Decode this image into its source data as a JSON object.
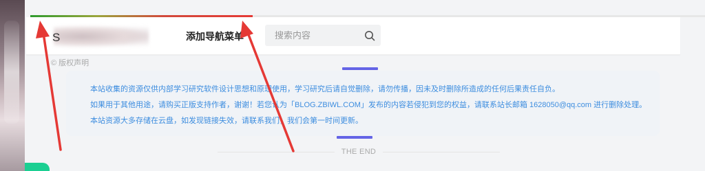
{
  "reading_progress": 0.33,
  "header": {
    "logo_letter": "S",
    "nav_item": "添加导航菜单",
    "search": {
      "placeholder": "搜索内容",
      "visible_text": "搜索内容"
    }
  },
  "article": {
    "copyright": "© 版权声明",
    "notice_lines": [
      "本站收集的资源仅供内部学习研究软件设计思想和原理使用，学习研究后请自觉删除，请勿传播，因未及时删除所造成的任何后果责任自负。",
      "如果用于其他用途，请购买正版支持作者，谢谢！若您认为「BLOG.ZBIWL.COM」发布的内容若侵犯到您的权益，请联系站长邮箱 1628050@qq.com 进行删除处理。",
      "本站资源大多存储在云盘，如发现链接失效，请联系我们，我们会第一时间更新。"
    ],
    "end_text": "THE END"
  },
  "colors": {
    "accent": "#6464e6",
    "notice_text": "#3d8ddf",
    "annotation_arrow": "#e53935",
    "float_button": "#1bcf92"
  },
  "icons": {
    "search": "search-icon"
  }
}
